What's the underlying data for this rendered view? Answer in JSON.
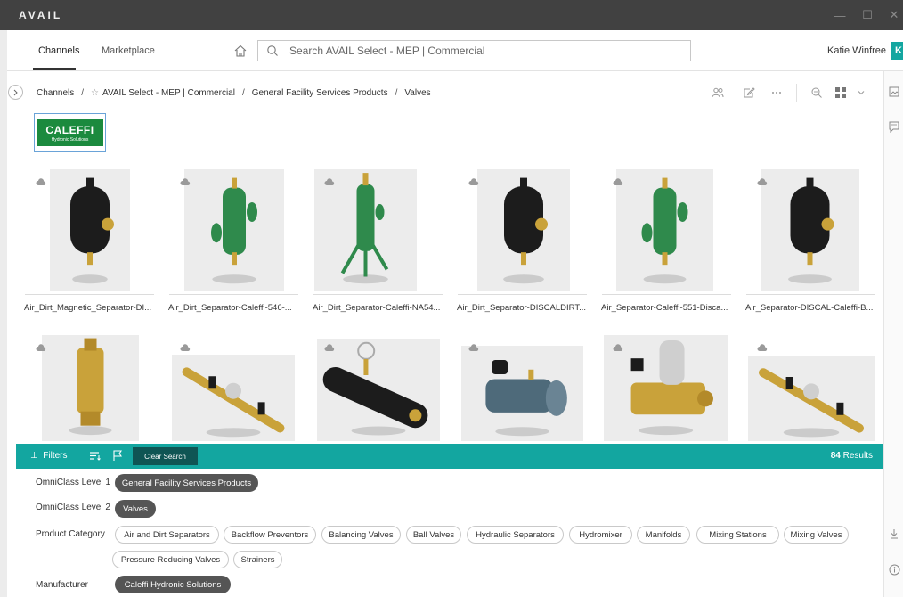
{
  "app": {
    "title": "AVAIL"
  },
  "window_controls": {
    "minimize": "—",
    "maximize": "☐",
    "close": "✕"
  },
  "nav": {
    "tabs": [
      {
        "label": "Channels",
        "active": true
      },
      {
        "label": "Marketplace",
        "active": false
      }
    ],
    "search_placeholder": "Search AVAIL Select - MEP | Commercial",
    "user_name": "Katie Winfree",
    "user_initial": "K"
  },
  "breadcrumb": {
    "items": [
      "Channels",
      "AVAIL Select - MEP | Commercial",
      "General Facility Services Products",
      "Valves"
    ],
    "separator": "/"
  },
  "manufacturer_logo": {
    "main": "CALEFFI",
    "sub": "Hydronic Solutions",
    "color": "#1b8a3e"
  },
  "products": [
    {
      "name": "Air_Dirt_Magnetic_Separator-DI..."
    },
    {
      "name": "Air_Dirt_Separator-Caleffi-546-..."
    },
    {
      "name": "Air_Dirt_Separator-Caleffi-NA54..."
    },
    {
      "name": "Air_Dirt_Separator-DISCALDIRT..."
    },
    {
      "name": "Air_Separator-Caleffi-551-Disca..."
    },
    {
      "name": "Air_Separator-DISCAL-Caleffi-B..."
    },
    {
      "name": ""
    },
    {
      "name": ""
    },
    {
      "name": ""
    },
    {
      "name": ""
    },
    {
      "name": ""
    },
    {
      "name": ""
    }
  ],
  "filter_bar": {
    "filters_label": "Filters",
    "clear_search_label": "Clear Search",
    "results_count": "84",
    "results_label": "Results",
    "color": "#13a6a0"
  },
  "filters": {
    "omniclass1": {
      "label": "OmniClass Level 1",
      "chips": [
        {
          "label": "General Facility Services Products",
          "active": true
        }
      ]
    },
    "omniclass2": {
      "label": "OmniClass Level 2",
      "chips": [
        {
          "label": "Valves",
          "active": true
        }
      ]
    },
    "product_category": {
      "label": "Product Category",
      "chips": [
        {
          "label": "Air and Dirt Separators",
          "active": false
        },
        {
          "label": "Backflow Preventors",
          "active": false
        },
        {
          "label": "Balancing Valves",
          "active": false
        },
        {
          "label": "Ball Valves",
          "active": false
        },
        {
          "label": "Hydraulic Separators",
          "active": false
        },
        {
          "label": "Hydromixer",
          "active": false
        },
        {
          "label": "Manifolds",
          "active": false
        },
        {
          "label": "Mixing Stations",
          "active": false
        },
        {
          "label": "Mixing Valves",
          "active": false
        },
        {
          "label": "Pressure Reducing Valves",
          "active": false
        },
        {
          "label": "Strainers",
          "active": false
        }
      ]
    },
    "manufacturer": {
      "label": "Manufacturer",
      "chips": [
        {
          "label": "Caleffi Hydronic Solutions",
          "active": true
        }
      ]
    }
  }
}
